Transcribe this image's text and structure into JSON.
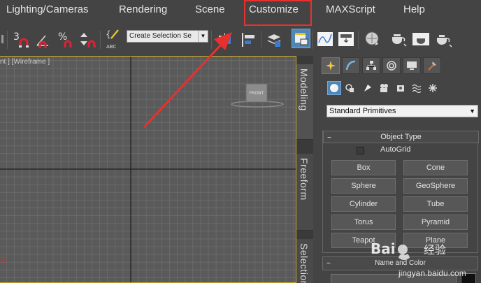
{
  "menubar": {
    "items": [
      {
        "label": "Lighting/Cameras"
      },
      {
        "label": "Rendering"
      },
      {
        "label": "Scene"
      },
      {
        "label": "Customize"
      },
      {
        "label": "MAXScript"
      },
      {
        "label": "Help"
      }
    ],
    "highlighted": "Customize",
    "highlight_color": "#e8312f"
  },
  "toolbar": {
    "snap_3_label": "3",
    "percent_label": "%",
    "selection_set_placeholder": "Create Selection Se",
    "icons": [
      "snap-3d-icon",
      "angle-snap-icon",
      "percent-snap-icon",
      "spinner-snap-icon",
      "edit-named-selection-icon",
      "mirror-icon",
      "align-icon",
      "layers-icon",
      "scene-explorer-icon",
      "curve-editor-icon",
      "schematic-view-icon",
      "material-editor-icon",
      "render-setup-icon",
      "rendered-frame-icon",
      "render-icon"
    ],
    "active_color": "#4d86b7"
  },
  "viewport": {
    "label": "nt ] [Wireframe ]",
    "viewcube_label": "FRONT",
    "axis_label": "Z",
    "border_color": "#c6a530"
  },
  "ribbon": {
    "tabs": [
      {
        "label": "Modeling"
      },
      {
        "label": "Freeform"
      },
      {
        "label": "Selection"
      }
    ]
  },
  "command_panel": {
    "tab_icons": [
      "create-icon",
      "modify-icon",
      "hierarchy-icon",
      "motion-icon",
      "display-icon",
      "utilities-icon"
    ],
    "object_icons": [
      "geometry-icon",
      "shapes-icon",
      "lights-icon",
      "cameras-icon",
      "helpers-icon",
      "space-warps-icon",
      "systems-icon"
    ],
    "category_value": "Standard Primitives",
    "object_type_title": "Object Type",
    "autogrid_label": "AutoGrid",
    "buttons": [
      {
        "label": "Box"
      },
      {
        "label": "Cone"
      },
      {
        "label": "Sphere"
      },
      {
        "label": "GeoSphere"
      },
      {
        "label": "Cylinder"
      },
      {
        "label": "Tube"
      },
      {
        "label": "Torus"
      },
      {
        "label": "Pyramid"
      },
      {
        "label": "Teapot"
      },
      {
        "label": "Plane"
      }
    ],
    "name_color_title": "Name and Color"
  },
  "watermark": {
    "text": "jingyan.baidu.com",
    "logo_text": "Bai 经验"
  }
}
